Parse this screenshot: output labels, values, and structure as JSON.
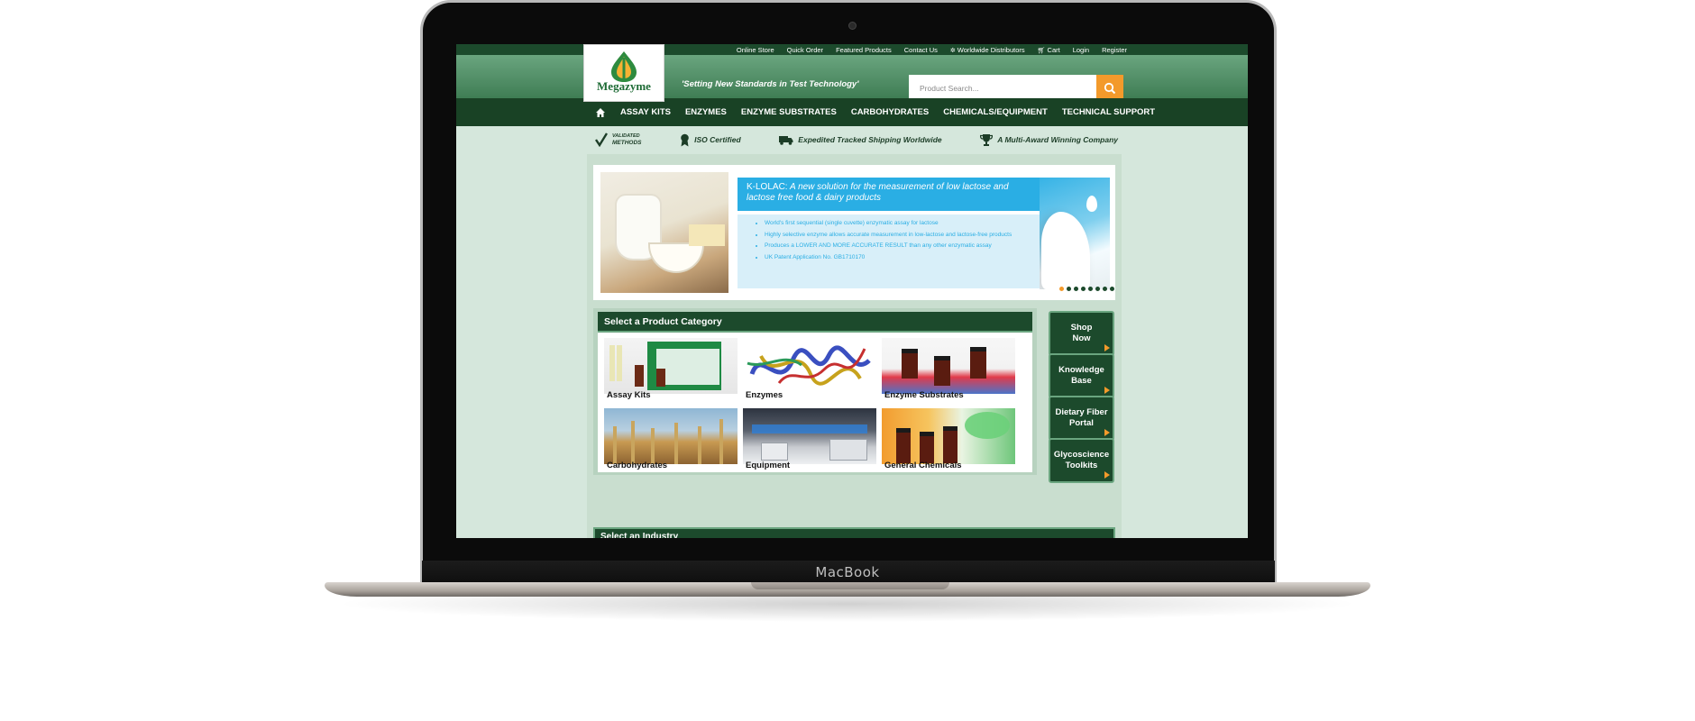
{
  "device": {
    "label": "MacBook"
  },
  "site": {
    "logo_text": "Megazyme",
    "tagline": "'Setting New Standards in Test Technology'",
    "colors": {
      "dark_green": "#1c4a2c",
      "accent_orange": "#f39a2b",
      "banner_blue": "#2aaee4"
    }
  },
  "top_links": [
    "Online Store",
    "Quick Order",
    "Featured Products",
    "Contact Us",
    "Worldwide Distributors",
    "Cart",
    "Login",
    "Register"
  ],
  "search": {
    "placeholder": "Product Search..."
  },
  "main_nav": [
    "ASSAY KITS",
    "ENZYMES",
    "ENZYME SUBSTRATES",
    "CARBOHYDRATES",
    "CHEMICALS/EQUIPMENT",
    "TECHNICAL SUPPORT"
  ],
  "features": {
    "validated": [
      "VALIDATED",
      "METHODS"
    ],
    "iso": "ISO Certified",
    "shipping": "Expedited Tracked Shipping Worldwide",
    "award": "A Multi-Award Winning Company"
  },
  "banner": {
    "title_prefix": "K-LOLAC:",
    "title_rest": " A new solution for the measurement of low lactose and lactose free food & dairy products",
    "bullets": [
      "World's first sequential (single cuvette) enzymatic assay for lactose",
      "Highly selective enzyme allows accurate measurement in low-lactose and lactose-free products",
      "Produces a LOWER AND MORE ACCURATE RESULT than any other enzymatic assay",
      "UK Patent Application No. GB1710170"
    ],
    "slides": 8,
    "active_slide": 1
  },
  "categories": {
    "header": "Select a Product Category",
    "items": [
      "Assay Kits",
      "Enzymes",
      "Enzyme Substrates",
      "Carbohydrates",
      "Equipment",
      "General Chemicals"
    ]
  },
  "side_buttons": [
    [
      "Shop",
      "Now"
    ],
    [
      "Knowledge",
      "Base"
    ],
    [
      "Dietary Fiber",
      "Portal"
    ],
    [
      "Glycoscience",
      "Toolkits"
    ]
  ],
  "industry": {
    "header": "Select an Industry"
  }
}
